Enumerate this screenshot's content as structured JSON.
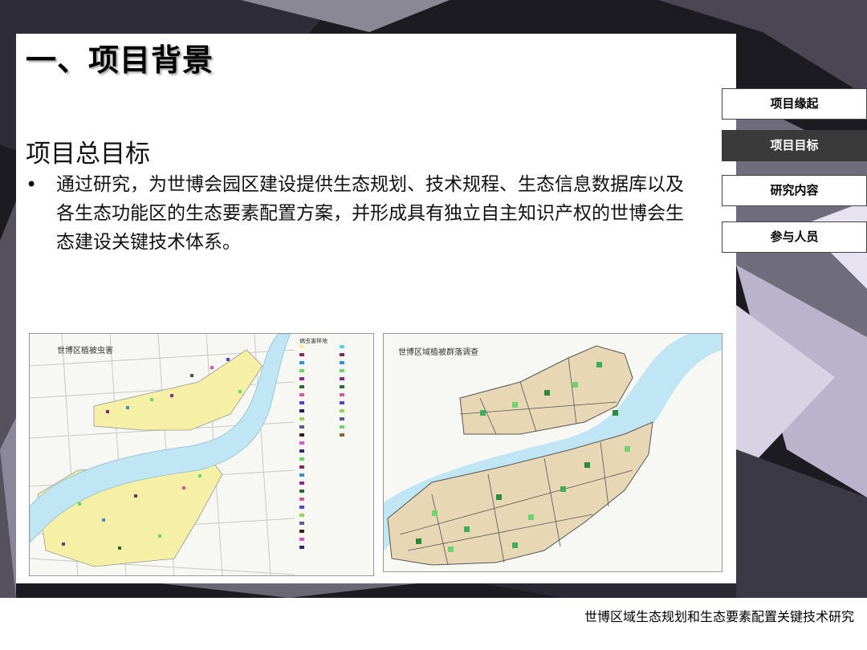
{
  "slide": {
    "title": "一、项目背景",
    "subtitle": "项目总目标",
    "bullets": [
      "通过研究，为世博会园区建设提供生态规划、技术规程、生态信息数据库以及各生态功能区的生态要素配置方案，并形成具有独立自主知识产权的世博会生态建设关键技术体系。"
    ]
  },
  "nav": {
    "items": [
      {
        "label": "项目缘起",
        "active": false
      },
      {
        "label": "项目目标",
        "active": true
      },
      {
        "label": "研究内容",
        "active": false
      },
      {
        "label": "参与人员",
        "active": false
      }
    ]
  },
  "maps": {
    "left_title": "世博区植被虫害",
    "right_title": "世博区域植被群落调查",
    "legend_heading": "病虫害样地"
  },
  "colors": {
    "river": "#bfe6f2",
    "zone_yellow": "#f5f0a6",
    "zone_tan": "#e8d7b4",
    "nav_active": "#3a3a3a"
  },
  "footer": {
    "text": "世博区域生态规划和生态要素配置关键技术研究"
  }
}
